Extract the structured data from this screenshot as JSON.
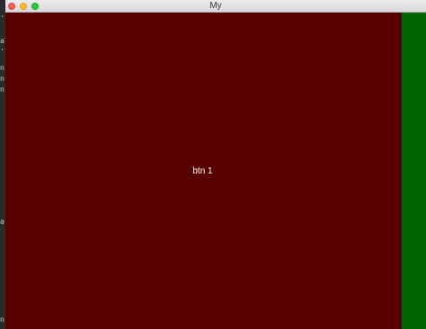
{
  "window": {
    "title": "My"
  },
  "content": {
    "button_1_label": "btn 1",
    "button_1_color": "#580000",
    "right_panel_color": "#006400"
  },
  "background_app": {
    "glyphs": [
      "'l",
      "al",
      "'l",
      "n",
      "n",
      "n",
      "a",
      "n"
    ]
  }
}
